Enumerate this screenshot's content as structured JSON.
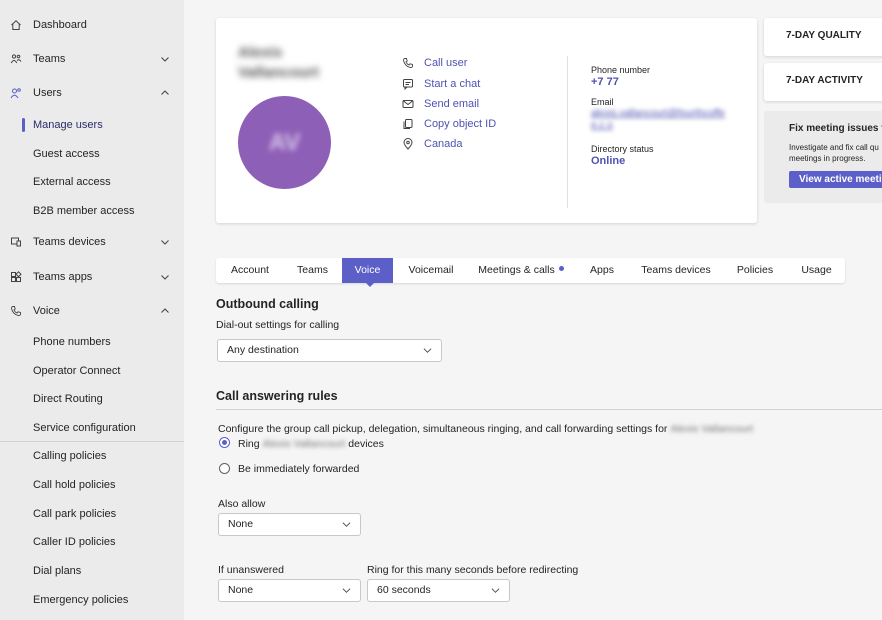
{
  "sidebar": {
    "items": [
      {
        "label": "Dashboard",
        "icon": "home-icon"
      },
      {
        "label": "Teams",
        "icon": "teams-icon"
      },
      {
        "label": "Users",
        "icon": "users-icon"
      },
      {
        "label": "Manage users"
      },
      {
        "label": "Guest access"
      },
      {
        "label": "External access"
      },
      {
        "label": "B2B member access"
      },
      {
        "label": "Teams devices",
        "icon": "devices-icon"
      },
      {
        "label": "Teams apps",
        "icon": "apps-icon"
      },
      {
        "label": "Voice",
        "icon": "phone-icon"
      },
      {
        "label": "Phone numbers"
      },
      {
        "label": "Operator Connect"
      },
      {
        "label": "Direct Routing"
      },
      {
        "label": "Service configuration"
      },
      {
        "label": "Calling policies"
      },
      {
        "label": "Call hold policies"
      },
      {
        "label": "Call park policies"
      },
      {
        "label": "Caller ID policies"
      },
      {
        "label": "Dial plans"
      },
      {
        "label": "Emergency policies"
      }
    ]
  },
  "profile": {
    "name": "Alexis Vallancourt",
    "avatar_initials": "AV",
    "avatar_color": "#8e5fb7",
    "actions": [
      {
        "label": "Call user",
        "icon": "phone-icon"
      },
      {
        "label": "Start a chat",
        "icon": "chat-icon"
      },
      {
        "label": "Send email",
        "icon": "mail-icon"
      },
      {
        "label": "Copy object ID",
        "icon": "copy-icon"
      },
      {
        "label": "Canada",
        "icon": "location-icon"
      }
    ],
    "phone_label": "Phone number",
    "phone_value": "+7 77",
    "email_label": "Email",
    "email_value": "alexis.vallancourt@fourthcoffee.c o",
    "status_label": "Directory status",
    "status_value": "Online"
  },
  "side_cards": {
    "quality_title": "7-DAY QUALITY",
    "activity_title": "7-DAY ACTIVITY",
    "fix_title": "Fix meeting issues f",
    "fix_desc": "Investigate and fix call qu meetings in progress.",
    "fix_button": "View active meetin"
  },
  "tabs": [
    {
      "label": "Account"
    },
    {
      "label": "Teams"
    },
    {
      "label": "Voice"
    },
    {
      "label": "Voicemail"
    },
    {
      "label": "Meetings & calls"
    },
    {
      "label": "Apps"
    },
    {
      "label": "Teams devices"
    },
    {
      "label": "Policies"
    },
    {
      "label": "Usage"
    }
  ],
  "outbound": {
    "title": "Outbound calling",
    "subtitle": "Dial-out settings for calling",
    "value": "Any destination"
  },
  "answering": {
    "title": "Call answering rules",
    "description": "Configure the group call pickup, delegation, simultaneous ringing, and call forwarding settings for",
    "user_name": "Alexis Vallancourt",
    "ring_prefix": "Ring",
    "ring_suffix": "devices",
    "forwarded_label": "Be immediately forwarded",
    "also_allow_label": "Also allow",
    "also_allow_value": "None",
    "if_unanswered_label": "If unanswered",
    "if_unanswered_value": "None",
    "ring_seconds_label": "Ring for this many seconds before redirecting",
    "ring_seconds_value": "60 seconds"
  }
}
